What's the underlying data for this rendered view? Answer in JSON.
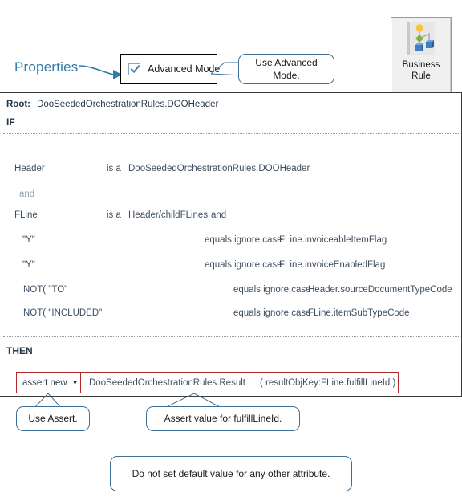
{
  "annotations": {
    "properties_label": "Properties",
    "advanced_mode_callout": "Use Advanced Mode.",
    "use_assert_callout": "Use Assert.",
    "assert_value_callout": "Assert value  for fulfillLineId.",
    "no_default_callout": "Do not set default value  for any other attribute."
  },
  "advanced_mode": {
    "label": "Advanced Mode",
    "checked": true,
    "check_color": "#2e7ca8"
  },
  "business_rule_tile": {
    "label_line1": "Business",
    "label_line2": "Rule",
    "icon": "business-rule-icon"
  },
  "rule": {
    "root_label": "Root:",
    "root_value": "DooSeededOrchestrationRules.DOOHeader",
    "if_label": "IF",
    "then_label": "THEN",
    "conditions": [
      {
        "left": "Header",
        "operator": "is a",
        "right": "DooSeededOrchestrationRules.DOOHeader",
        "trailing": ""
      },
      {
        "connector": "and"
      },
      {
        "left": "FLine",
        "operator": "is a",
        "right": "Header/childFLines",
        "trailing": "and"
      },
      {
        "left": "\"Y\"",
        "operator": "equals ignore case",
        "right": "FLine.invoiceableItemFlag",
        "trailing": ""
      },
      {
        "left": "\"Y\"",
        "operator": "equals ignore case",
        "right": "FLine.invoiceEnabledFlag",
        "trailing": ""
      },
      {
        "left": "NOT( \"TO\"",
        "operator": "equals ignore case",
        "right": "Header.sourceDocumentTypeCode",
        "trailing": ""
      },
      {
        "left": "NOT( \"INCLUDED\"",
        "operator": "equals ignore case",
        "right": "FLine.itemSubTypeCode",
        "trailing": ""
      }
    ],
    "action": {
      "verb": "assert new",
      "caret": "▼",
      "target": "DooSeededOrchestrationRules.Result",
      "argument": "( resultObjKey:FLine.fulfillLineId )",
      "border_color": "#b02a2a"
    }
  },
  "colors": {
    "accent_blue": "#2e7ca8",
    "callout_border": "#3f6f96",
    "panel_border": "#3a3a3a",
    "text": "#2b3a4a",
    "muted": "#9aa4af"
  }
}
